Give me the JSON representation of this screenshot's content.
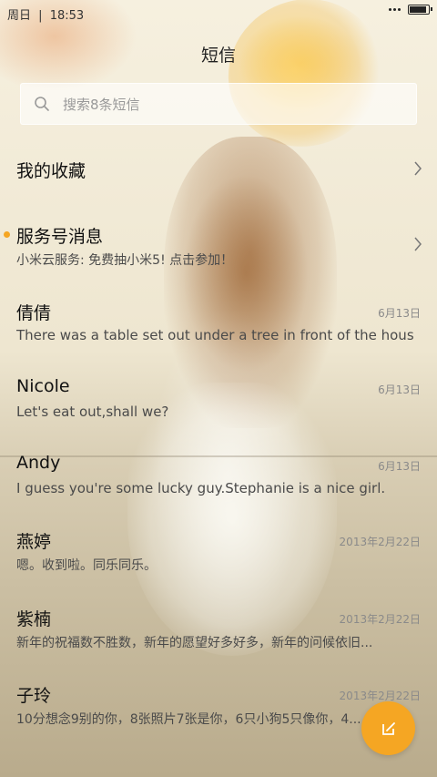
{
  "status_bar": {
    "day": "周日",
    "time": "18:53",
    "separator": "|"
  },
  "header": {
    "title": "短信"
  },
  "search": {
    "placeholder": "搜索8条短信"
  },
  "favorites": {
    "label": "我的收藏"
  },
  "service": {
    "title": "服务号消息",
    "preview": "小米云服务: 免费抽小米5! 点击参加！"
  },
  "messages": [
    {
      "name": "倩倩",
      "date": "6月13日",
      "preview": "There was a table set out under a tree in front of the hous"
    },
    {
      "name": "Nicole",
      "date": "6月13日",
      "preview": "Let's eat out,shall we?"
    },
    {
      "name": "Andy",
      "date": "6月13日",
      "preview": "I guess you're some lucky guy.Stephanie is a nice girl."
    },
    {
      "name": "燕婷",
      "date": "2013年2月22日",
      "preview": "嗯。收到啦。同乐同乐。"
    },
    {
      "name": "紫楠",
      "date": "2013年2月22日",
      "preview": "新年的祝福数不胜数，新年的愿望好多好多，新年的问候依旧..."
    },
    {
      "name": "子玲",
      "date": "2013年2月22日",
      "preview": "10分想念9别的你，8张照片7张是你，6只小狗5只像你，4..."
    }
  ],
  "battery": {
    "level_percent": 90
  },
  "icons": {
    "search": "search-icon",
    "chevron": "chevron-right-icon",
    "compose": "compose-icon",
    "unread": "unread-dot"
  },
  "colors": {
    "accent": "#f5a623",
    "unread_dot": "#f5a623"
  }
}
